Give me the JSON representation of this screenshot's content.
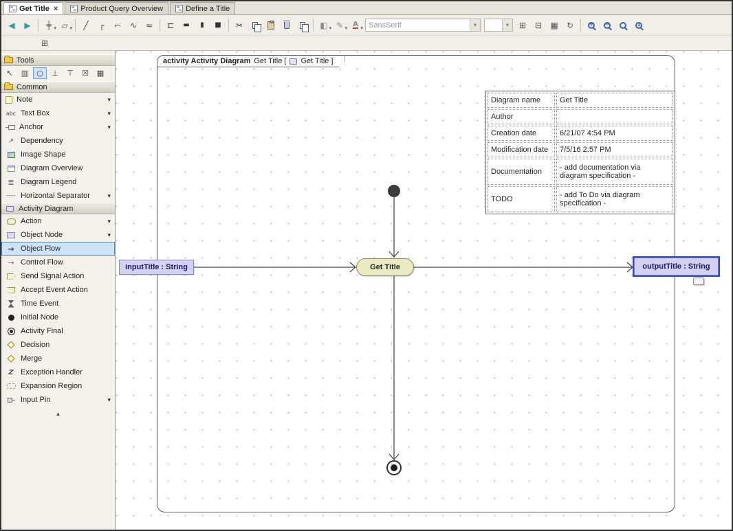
{
  "tabs": [
    {
      "label": "Get Title",
      "active": true
    },
    {
      "label": "Product Query Overview",
      "active": false
    },
    {
      "label": "Define a Title",
      "active": false
    }
  ],
  "toolbar": {
    "font_family_value": "SansSerif",
    "font_size_value": ""
  },
  "sidebar": {
    "sections": {
      "tools": {
        "title": "Tools"
      },
      "common": {
        "title": "Common",
        "items": [
          {
            "label": "Note"
          },
          {
            "label": "Text Box"
          },
          {
            "label": "Anchor"
          },
          {
            "label": "Dependency"
          },
          {
            "label": "Image Shape"
          },
          {
            "label": "Diagram Overview"
          },
          {
            "label": "Diagram Legend"
          },
          {
            "label": "Horizontal Separator"
          }
        ]
      },
      "activity": {
        "title": "Activity Diagram",
        "items": [
          {
            "label": "Action"
          },
          {
            "label": "Object Node"
          },
          {
            "label": "Object Flow",
            "selected": true
          },
          {
            "label": "Control Flow"
          },
          {
            "label": "Send Signal Action"
          },
          {
            "label": "Accept Event Action"
          },
          {
            "label": "Time Event"
          },
          {
            "label": "Initial Node"
          },
          {
            "label": "Activity Final"
          },
          {
            "label": "Decision"
          },
          {
            "label": "Merge"
          },
          {
            "label": "Exception Handler"
          },
          {
            "label": "Expansion Region"
          },
          {
            "label": "Input Pin"
          }
        ]
      }
    }
  },
  "canvas": {
    "frame": {
      "heading_bold": "activity Activity Diagram",
      "heading_name": "Get Title [",
      "heading_ref": "Get Title ]"
    },
    "nodes": {
      "action": "Get Title",
      "input_pin": "inputTitle : String",
      "output_pin": "outputTitle : String"
    },
    "info_table": [
      {
        "key": "Diagram name",
        "value": "Get Title"
      },
      {
        "key": "Author",
        "value": ""
      },
      {
        "key": "Creation date",
        "value": "6/21/07 4:54 PM"
      },
      {
        "key": "Modification date",
        "value": "7/5/16 2:57 PM"
      },
      {
        "key": "Documentation",
        "value": "- add documentation via diagram specification -"
      },
      {
        "key": "TODO",
        "value": "- add To Do via diagram specification -"
      }
    ]
  },
  "colors": {
    "selection_blue": "#2b46cc",
    "action_fill": "#e9e9c2",
    "object_node_fill": "#d2d2f0",
    "palette_highlight": "#cfe4f8"
  },
  "icons": {
    "close": "×",
    "chevron_down": "▾",
    "scroll_up": "▲"
  }
}
